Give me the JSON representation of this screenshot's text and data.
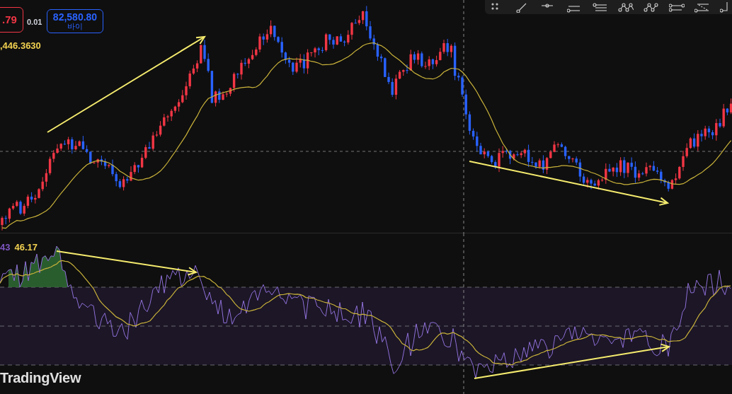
{
  "order_panel": {
    "sell_price": ".79",
    "spread": "0.01",
    "buy_price": "82,580.80",
    "buy_label": "바이"
  },
  "moving_average_value": ",446.3630",
  "rsi_panel": {
    "rsi_value": "43",
    "rsi_ma_value": "46.17"
  },
  "logo": "TradingView"
}
